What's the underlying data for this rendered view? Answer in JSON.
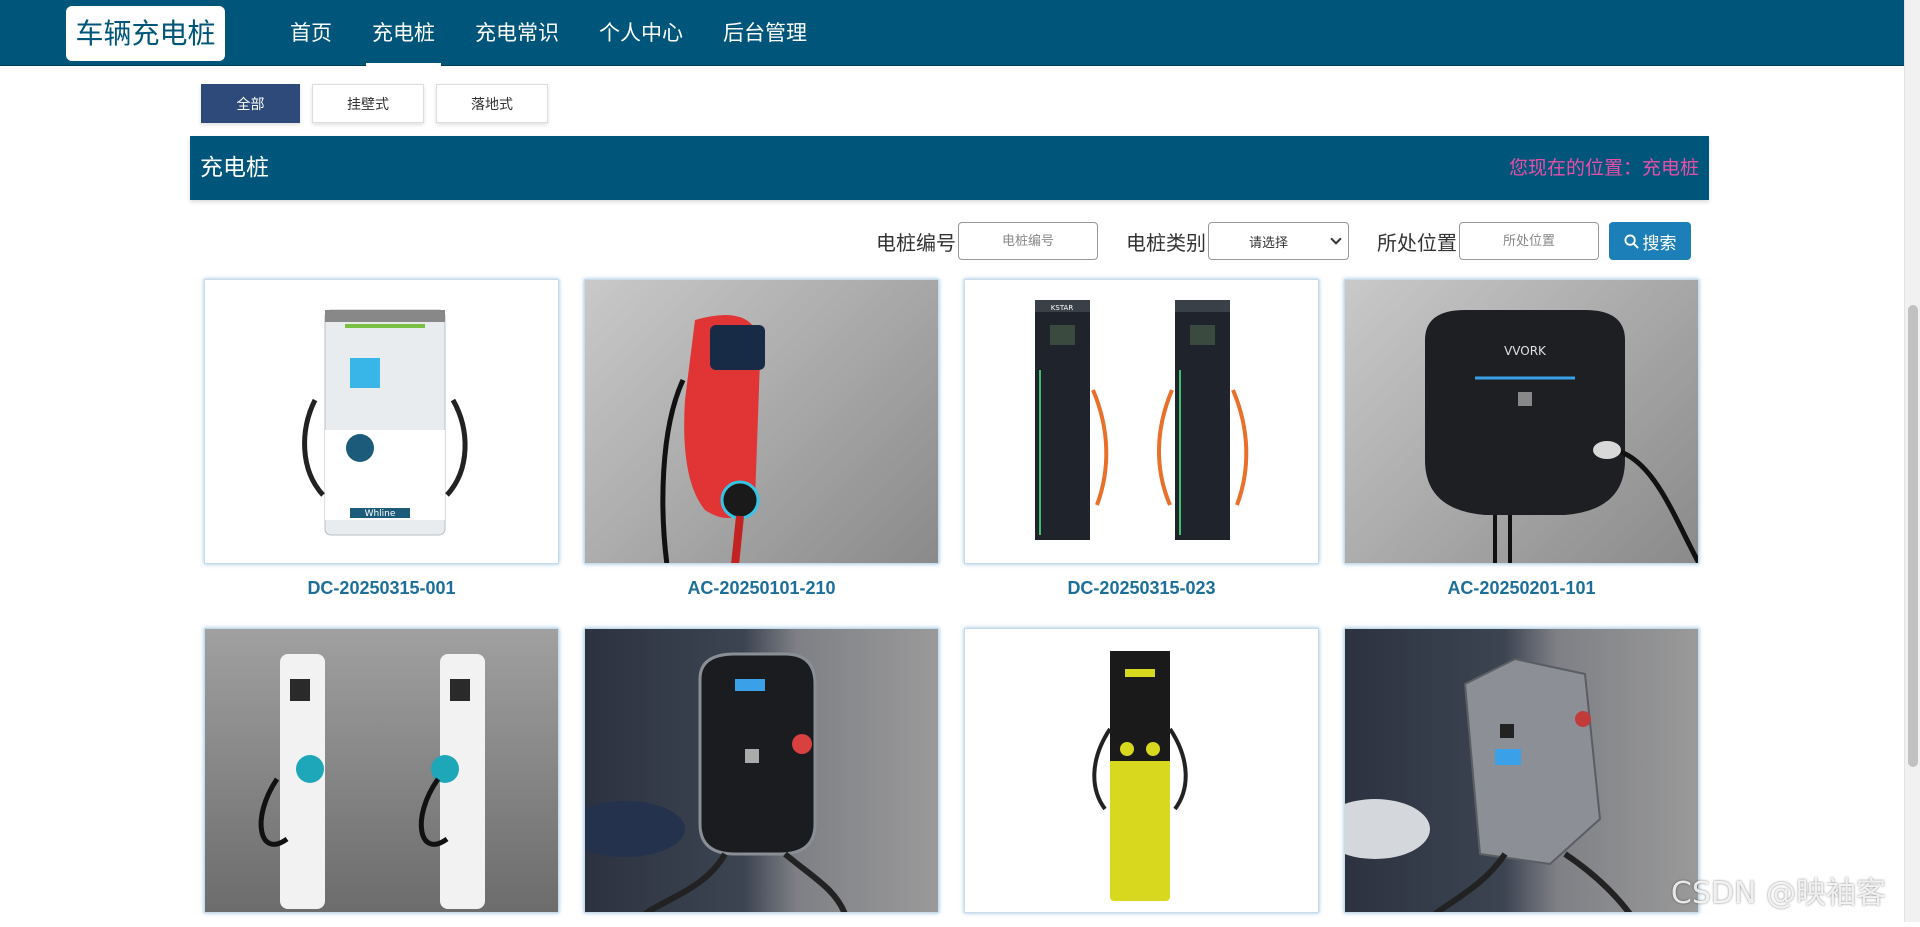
{
  "header": {
    "brand": "车辆充电桩",
    "nav": [
      "首页",
      "充电桩",
      "充电常识",
      "个人中心",
      "后台管理"
    ],
    "active_nav": "充电桩"
  },
  "filters": [
    "全部",
    "挂壁式",
    "落地式"
  ],
  "active_filter": "全部",
  "section": {
    "title": "充电桩",
    "breadcrumb": "您现在的位置：充电桩"
  },
  "search": {
    "code_label": "电桩编号",
    "code_placeholder": "电桩编号",
    "type_label": "电桩类别",
    "type_value": "请选择",
    "location_label": "所处位置",
    "location_placeholder": "所处位置",
    "button": "搜索"
  },
  "cards": [
    {
      "title": "DC-20250315-001"
    },
    {
      "title": "AC-20250101-210"
    },
    {
      "title": "DC-20250315-023"
    },
    {
      "title": "AC-20250201-101"
    },
    {
      "title": ""
    },
    {
      "title": ""
    },
    {
      "title": ""
    },
    {
      "title": ""
    }
  ],
  "images": {
    "card1_brand": "Whline",
    "card4_brand": "VVORK",
    "card3_brand": "KSTAR"
  },
  "watermark": "CSDN @映袖客",
  "colors": {
    "primary": "#00567a",
    "active_filter": "#2e4a7b",
    "breadcrumb": "#e84ea8",
    "card_title": "#1c6f9a",
    "search_button": "#1c7fb8"
  }
}
